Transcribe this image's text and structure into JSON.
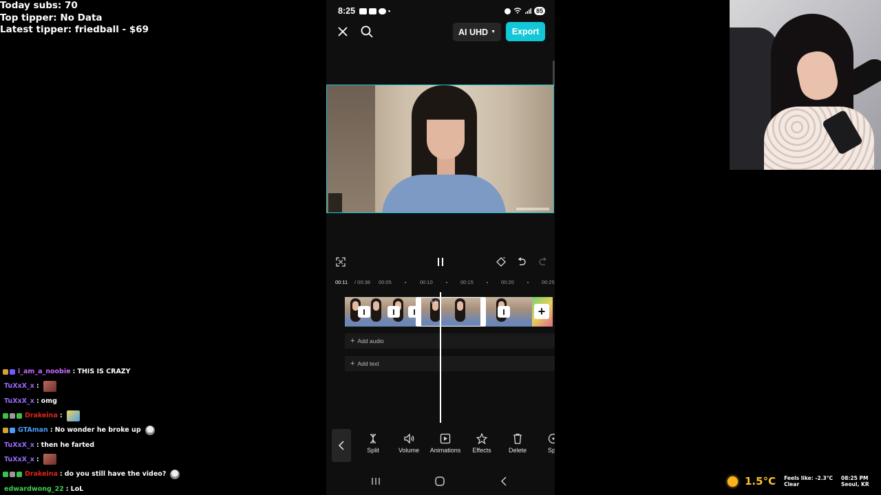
{
  "stream_overlay": {
    "today_subs": "Today subs: 70",
    "top_tipper": "Top tipper: No Data",
    "latest_tipper": "Latest tipper: friedball - $69"
  },
  "chat": [
    {
      "user": "i_am_a_noobie",
      "user_color": "#c86bff",
      "separator": ":",
      "message": "THIS IS CRAZY",
      "badges": [
        "#d9a035",
        "#6a5cff"
      ],
      "emote": ""
    },
    {
      "user": "TuXxX_x",
      "user_color": "#9d6bff",
      "separator": ":",
      "message": "",
      "badges": [],
      "emote": "face-emote"
    },
    {
      "user": "TuXxX_x",
      "user_color": "#9d6bff",
      "separator": ":",
      "message": "omg",
      "badges": [],
      "emote": ""
    },
    {
      "user": "Drakeina",
      "user_color": "#e0241b",
      "separator": ":",
      "message": "",
      "badges": [
        "#3ec04b",
        "#999999",
        "#3ec04b"
      ],
      "emote": "doge-emote"
    },
    {
      "user": "GTAman",
      "user_color": "#4b9cff",
      "separator": ":",
      "message": "No wonder he broke up",
      "badges": [
        "#d9a035",
        "#4b9cff"
      ],
      "emote": "avatar-emote"
    },
    {
      "user": "TuXxX_x",
      "user_color": "#9d6bff",
      "separator": ":",
      "message": "then he farted",
      "badges": [],
      "emote": ""
    },
    {
      "user": "TuXxX_x",
      "user_color": "#9d6bff",
      "separator": ":",
      "message": "",
      "badges": [],
      "emote": "face-emote"
    },
    {
      "user": "Drakeina",
      "user_color": "#e0241b",
      "separator": ":",
      "message": "do you still have the video?",
      "badges": [
        "#3ec04b",
        "#999999",
        "#3ec04b"
      ],
      "emote": "avatar-emote"
    },
    {
      "user": "edwardwong_22",
      "user_color": "#3fd14b",
      "separator": ":",
      "message": "LoL",
      "badges": [],
      "emote": ""
    }
  ],
  "phone": {
    "status_time": "8:25",
    "battery": "85",
    "quality_label": "AI UHD",
    "export_label": "Export",
    "accent_color": "#14c7d6",
    "timeline": {
      "current": "00:11",
      "total": "/ 00:38",
      "ticks": [
        "00:05",
        "00:10",
        "00:15",
        "00:20",
        "00:25"
      ],
      "selected_clip_duration": "5.7s"
    },
    "lanes": {
      "audio": "Add audio",
      "text": "Add text"
    },
    "tools": [
      {
        "label": "Split",
        "icon": "split-icon"
      },
      {
        "label": "Volume",
        "icon": "volume-icon"
      },
      {
        "label": "Animations",
        "icon": "animations-icon"
      },
      {
        "label": "Effects",
        "icon": "effects-icon"
      },
      {
        "label": "Delete",
        "icon": "delete-icon"
      },
      {
        "label": "Spe",
        "icon": "speed-icon"
      }
    ]
  },
  "weather": {
    "temperature": "1.5°C",
    "feels_like": "Feels like: -2.3°C",
    "condition": "Clear",
    "time": "08:25 PM",
    "location": "Seoul, KR"
  }
}
